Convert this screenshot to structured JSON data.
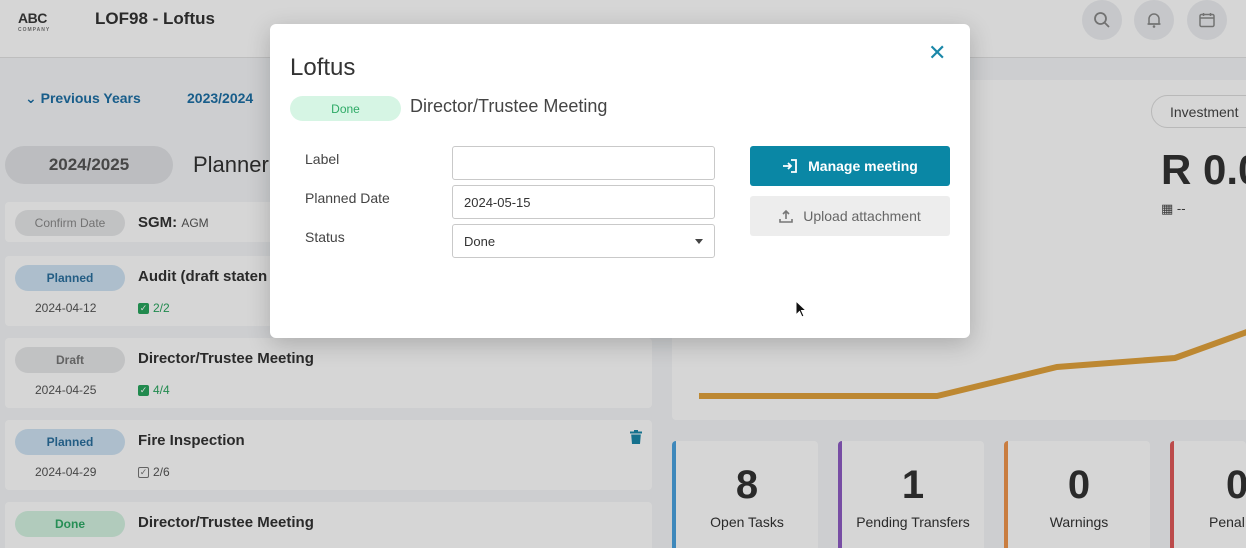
{
  "header": {
    "logo": "ABC",
    "logo_sub": "COMPANY",
    "title": "LOF98 - Loftus"
  },
  "nav": {
    "previous_years": "Previous Years",
    "year_link": "2023/2024",
    "current_year": "2024/2025",
    "planner_title": "Planner"
  },
  "meetings": [
    {
      "status": "Confirm Date",
      "title": "SGM:",
      "subtitle": "AGM",
      "date": "",
      "tasks": ""
    },
    {
      "status": "Planned",
      "title": "Audit (draft staten",
      "subtitle": "",
      "date": "2024-04-12",
      "tasks": "2/2"
    },
    {
      "status": "Draft",
      "title": "Director/Trustee Meeting",
      "subtitle": "",
      "date": "2024-04-25",
      "tasks": "4/4"
    },
    {
      "status": "Planned",
      "title": "Fire Inspection",
      "subtitle": "",
      "date": "2024-04-29",
      "tasks": "2/6"
    },
    {
      "status": "Done",
      "title": "Director/Trustee Meeting",
      "subtitle": "",
      "date": "",
      "tasks": ""
    }
  ],
  "right": {
    "investment_label": "Investment",
    "amount": "R 0.0",
    "amount_sub": "--"
  },
  "stats": [
    {
      "value": "8",
      "label": "Open Tasks",
      "color": "#4aa3df"
    },
    {
      "value": "1",
      "label": "Pending Transfers",
      "color": "#8e5cc4"
    },
    {
      "value": "0",
      "label": "Warnings",
      "color": "#f0964d"
    },
    {
      "value": "0",
      "label": "Penal",
      "color": "#e05a5a"
    }
  ],
  "modal": {
    "title": "Loftus",
    "status_badge": "Done",
    "subtitle": "Director/Trustee Meeting",
    "fields": {
      "label_label": "Label",
      "label_value": "",
      "planned_date_label": "Planned Date",
      "planned_date_value": "2024-05-15",
      "status_label": "Status",
      "status_value": "Done"
    },
    "manage_button": "Manage meeting",
    "upload_button": "Upload attachment"
  },
  "colors": {
    "accent": "#0a87a5",
    "link": "#1d6fa5",
    "done_green": "#2eaa66",
    "chart_line": "#e2a23c"
  },
  "icons": [
    "search-icon",
    "bell-icon",
    "calendar-icon",
    "chevron-down-icon",
    "check-icon",
    "trash-icon",
    "close-icon",
    "sign-in-icon",
    "upload-icon"
  ]
}
